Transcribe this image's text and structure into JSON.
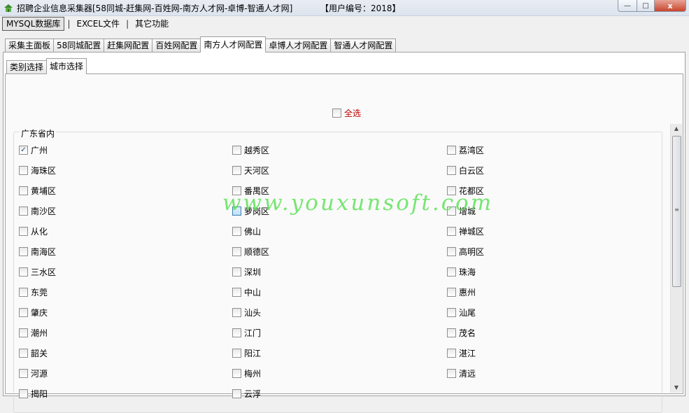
{
  "window": {
    "title": "招聘企业信息采集器[58同城-赶集网-百姓网-南方人才网-卓博-智通人才网]",
    "user_label": "【用户编号：2018】",
    "min_glyph": "—",
    "max_glyph": "□",
    "close_glyph": "x"
  },
  "menu": {
    "items": [
      "MYSQL数据库",
      "EXCEL文件",
      "其它功能"
    ],
    "separator": "|"
  },
  "main_tabs": [
    "采集主面板",
    "58同城配置",
    "赶集网配置",
    "百姓网配置",
    "南方人才网配置",
    "卓博人才网配置",
    "智通人才网配置"
  ],
  "sub_tabs": [
    "类别选择",
    "城市选择"
  ],
  "select_all_label": "全选",
  "group_title": "广东省内",
  "cities": [
    {
      "label": "广州",
      "checked": true
    },
    {
      "label": "越秀区",
      "checked": false
    },
    {
      "label": "荔湾区",
      "checked": false
    },
    {
      "label": "海珠区",
      "checked": false
    },
    {
      "label": "天河区",
      "checked": false
    },
    {
      "label": "白云区",
      "checked": false
    },
    {
      "label": "黄埔区",
      "checked": false
    },
    {
      "label": "番禺区",
      "checked": false
    },
    {
      "label": "花都区",
      "checked": false
    },
    {
      "label": "南沙区",
      "checked": false
    },
    {
      "label": "萝岗区",
      "checked": false
    },
    {
      "label": "增城",
      "checked": false
    },
    {
      "label": "从化",
      "checked": false
    },
    {
      "label": "佛山",
      "checked": false
    },
    {
      "label": "禅城区",
      "checked": false
    },
    {
      "label": "南海区",
      "checked": false
    },
    {
      "label": "顺德区",
      "checked": false
    },
    {
      "label": "高明区",
      "checked": false
    },
    {
      "label": "三水区",
      "checked": false
    },
    {
      "label": "深圳",
      "checked": false
    },
    {
      "label": "珠海",
      "checked": false
    },
    {
      "label": "东莞",
      "checked": false
    },
    {
      "label": "中山",
      "checked": false
    },
    {
      "label": "惠州",
      "checked": false
    },
    {
      "label": "肇庆",
      "checked": false
    },
    {
      "label": "汕头",
      "checked": false
    },
    {
      "label": "汕尾",
      "checked": false
    },
    {
      "label": "潮州",
      "checked": false
    },
    {
      "label": "江门",
      "checked": false
    },
    {
      "label": "茂名",
      "checked": false
    },
    {
      "label": "韶关",
      "checked": false
    },
    {
      "label": "阳江",
      "checked": false
    },
    {
      "label": "湛江",
      "checked": false
    },
    {
      "label": "河源",
      "checked": false
    },
    {
      "label": "梅州",
      "checked": false
    },
    {
      "label": "清远",
      "checked": false
    },
    {
      "label": "揭阳",
      "checked": false
    },
    {
      "label": "云浮",
      "checked": false
    }
  ],
  "watermark": "www.youxunsoft.com",
  "colors": {
    "select_all_text": "#c00000",
    "watermark": "#5fe35a"
  }
}
